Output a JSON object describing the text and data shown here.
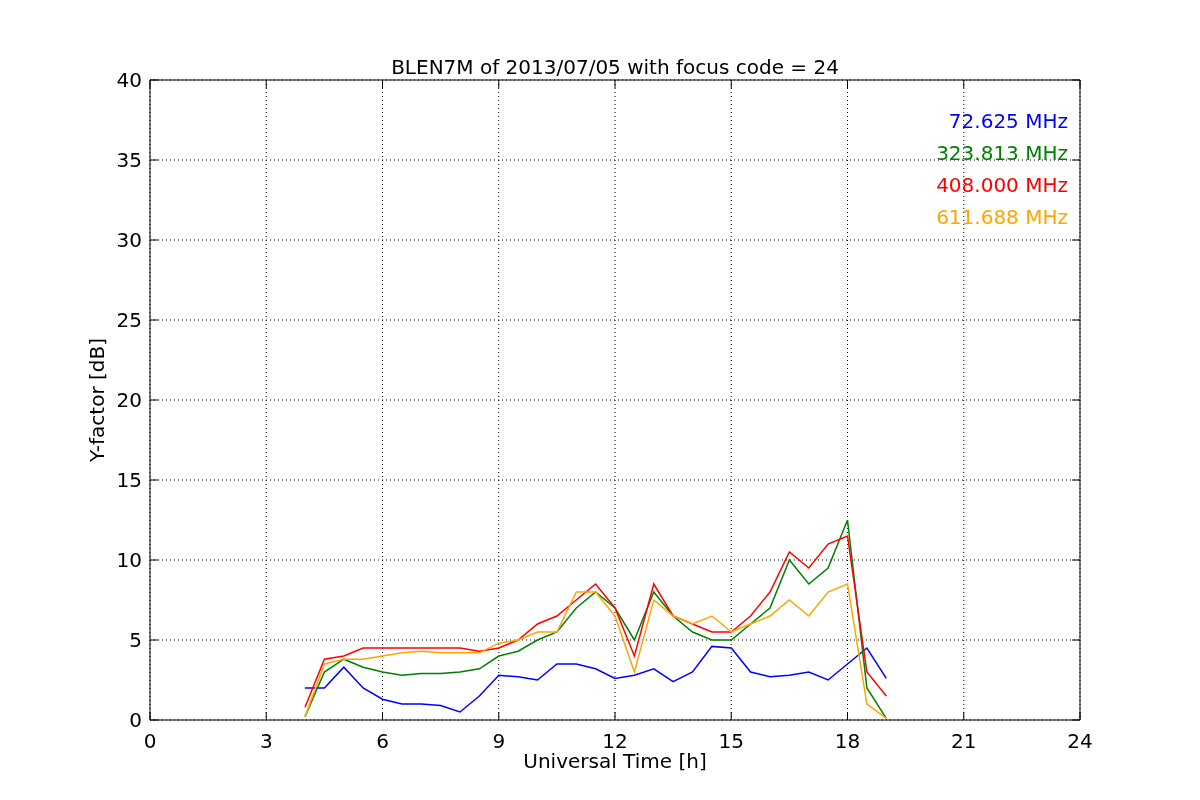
{
  "chart_data": {
    "type": "line",
    "title": "BLEN7M of 2013/07/05 with focus code = 24",
    "xlabel": "Universal Time [h]",
    "ylabel": "Y-factor [dB]",
    "x": [
      4,
      4.5,
      5,
      5.5,
      6,
      6.5,
      7,
      7.5,
      8,
      8.5,
      9,
      9.5,
      10,
      10.5,
      11,
      11.5,
      12,
      12.5,
      13,
      13.5,
      14,
      14.5,
      15,
      15.5,
      16,
      16.5,
      17,
      17.5,
      18,
      18.5,
      19
    ],
    "series": [
      {
        "name": "72.625 MHz",
        "color": "#0000ff",
        "values": [
          2.0,
          2.0,
          3.3,
          2.0,
          1.3,
          1.0,
          1.0,
          0.9,
          0.5,
          1.5,
          2.8,
          2.7,
          2.5,
          3.5,
          3.5,
          3.2,
          2.6,
          2.8,
          3.2,
          2.4,
          3.0,
          4.6,
          4.5,
          3.0,
          2.7,
          2.8,
          3.0,
          2.5,
          3.5,
          4.5,
          2.6
        ]
      },
      {
        "name": "323.813 MHz",
        "color": "#008000",
        "values": [
          0.2,
          3.0,
          3.8,
          3.3,
          3.0,
          2.8,
          2.9,
          2.9,
          3.0,
          3.2,
          4.0,
          4.3,
          5.0,
          5.5,
          7.0,
          8.0,
          7.0,
          5.0,
          8.0,
          6.5,
          5.5,
          5.0,
          5.0,
          6.0,
          7.0,
          10.0,
          8.5,
          9.5,
          12.5,
          2.0,
          0.1
        ]
      },
      {
        "name": "408.000 MHz",
        "color": "#ff0000",
        "values": [
          0.8,
          3.8,
          4.0,
          4.5,
          4.5,
          4.5,
          4.5,
          4.5,
          4.5,
          4.3,
          4.5,
          5.0,
          6.0,
          6.5,
          7.5,
          8.5,
          7.0,
          4.0,
          8.5,
          6.5,
          6.0,
          5.5,
          5.5,
          6.5,
          8.0,
          10.5,
          9.5,
          11.0,
          11.5,
          3.0,
          1.5
        ]
      },
      {
        "name": "611.688 MHz",
        "color": "#ffa500",
        "values": [
          0.2,
          3.5,
          3.8,
          3.8,
          4.0,
          4.2,
          4.3,
          4.2,
          4.2,
          4.2,
          4.8,
          5.0,
          5.5,
          5.5,
          8.0,
          8.0,
          6.5,
          3.0,
          7.5,
          6.5,
          6.0,
          6.5,
          5.5,
          6.0,
          6.5,
          7.5,
          6.5,
          8.0,
          8.5,
          1.0,
          0.1
        ]
      }
    ],
    "xlim": [
      0,
      24
    ],
    "ylim": [
      0,
      40
    ],
    "xticks": [
      0,
      3,
      6,
      9,
      12,
      15,
      18,
      21,
      24
    ],
    "yticks": [
      0,
      5,
      10,
      15,
      20,
      25,
      30,
      35,
      40
    ],
    "grid": true
  }
}
